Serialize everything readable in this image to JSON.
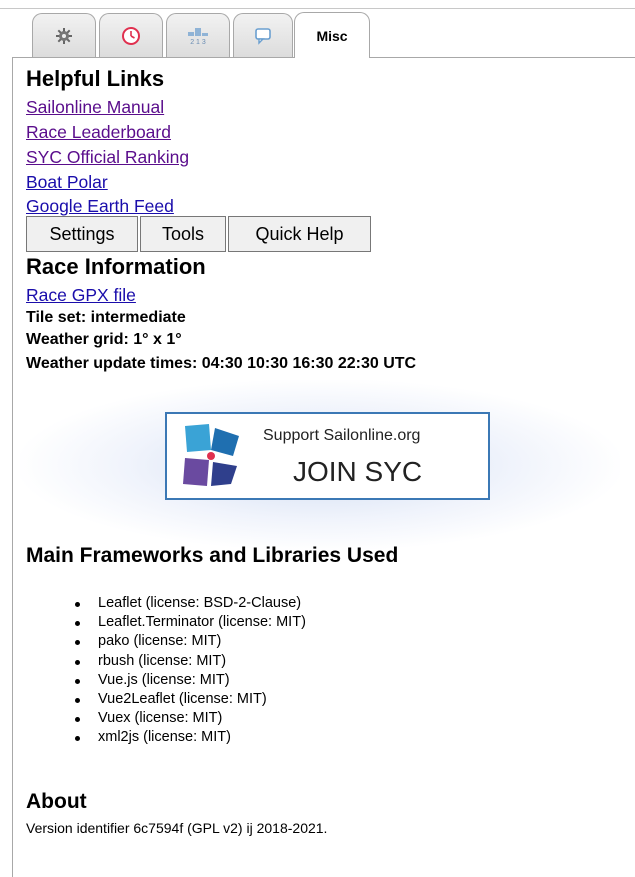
{
  "tabs": [
    {
      "icon": "gear-icon",
      "label": ""
    },
    {
      "icon": "clock-icon",
      "label": ""
    },
    {
      "icon": "ranking-icon",
      "label": ""
    },
    {
      "icon": "chat-bubble-icon",
      "label": ""
    },
    {
      "icon": "",
      "label": "Misc"
    }
  ],
  "helpful_links": {
    "title": "Helpful Links",
    "items": [
      {
        "label": "Sailonline Manual",
        "visited": true
      },
      {
        "label": "Race Leaderboard",
        "visited": true
      },
      {
        "label": "SYC Official Ranking",
        "visited": true
      },
      {
        "label": "Boat Polar",
        "visited": false
      },
      {
        "label": "Google Earth Feed",
        "visited": false
      }
    ]
  },
  "buttons": {
    "settings": "Settings",
    "tools": "Tools",
    "quick_help": "Quick Help"
  },
  "race_info": {
    "title": "Race Information",
    "gpx_link": "Race GPX file",
    "tile_set": "Tile set: intermediate",
    "weather_grid": "Weather grid: 1° x 1°",
    "weather_update": "Weather update times: 04:30 10:30 16:30 22:30 UTC"
  },
  "banner": {
    "line1": "Support Sailonline.org",
    "line2": "JOIN SYC"
  },
  "frameworks": {
    "title": "Main Frameworks and Libraries Used",
    "items": [
      "Leaflet (license: BSD-2-Clause)",
      "Leaflet.Terminator (license: MIT)",
      "pako (license: MIT)",
      "rbush (license: MIT)",
      "Vue.js (license: MIT)",
      "Vue2Leaflet (license: MIT)",
      "Vuex (license: MIT)",
      "xml2js (license: MIT)"
    ]
  },
  "about": {
    "title": "About",
    "version": "Version identifier 6c7594f (GPL v2) ij 2018-2021."
  },
  "colors": {
    "link": "#1a0dab",
    "visited_link": "#5a0d8c",
    "banner_border": "#3b78b5",
    "icon_red": "#e0304f"
  }
}
